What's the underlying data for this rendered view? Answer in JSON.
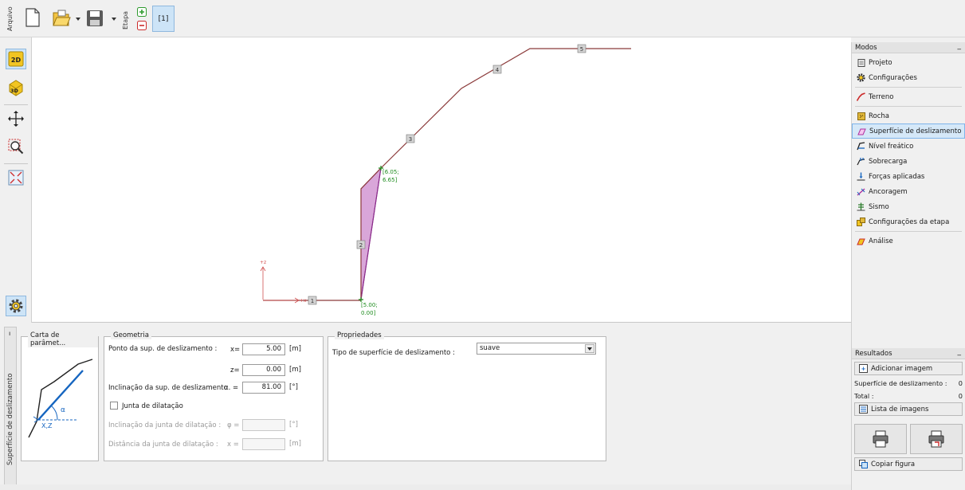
{
  "toolbar": {
    "file_label": "Arquivo",
    "stage_label": "Etapa",
    "stage_tab": "[1]"
  },
  "canvas": {
    "point_labels": [
      "1",
      "2",
      "3",
      "4",
      "5"
    ],
    "top_point_coord_line1": "[6.05;",
    "top_point_coord_line2": "6.65]",
    "bottom_point_coord_line1": "[5.00;",
    "bottom_point_coord_line2": "0.00]",
    "axis_z_label": "+z",
    "axis_x_label": "+x"
  },
  "modes": {
    "header": "Modos",
    "items": [
      {
        "label": "Projeto",
        "icon": "document-icon"
      },
      {
        "label": "Configurações",
        "icon": "gear-icon"
      },
      {
        "label": "Terreno",
        "icon": "terrain-icon"
      },
      {
        "label": "Rocha",
        "icon": "rock-icon"
      },
      {
        "label": "Superfície de deslizamento",
        "icon": "slip-surface-icon",
        "active": true
      },
      {
        "label": "Nível freático",
        "icon": "water-table-icon"
      },
      {
        "label": "Sobrecarga",
        "icon": "surcharge-icon"
      },
      {
        "label": "Forças aplicadas",
        "icon": "applied-forces-icon"
      },
      {
        "label": "Ancoragem",
        "icon": "anchor-icon"
      },
      {
        "label": "Sismo",
        "icon": "earthquake-icon"
      },
      {
        "label": "Configurações da etapa",
        "icon": "stage-settings-icon"
      },
      {
        "label": "Análise",
        "icon": "analysis-icon"
      }
    ]
  },
  "results": {
    "header": "Resultados",
    "add_image": "Adicionar imagem",
    "slip_label": "Superfície de deslizamento :",
    "slip_value": "0",
    "total_label": "Total :",
    "total_value": "0",
    "image_list": "Lista de imagens",
    "copy_figure": "Copiar figura"
  },
  "bottom": {
    "side_tab": "Superfície de deslizamento",
    "param_card": "Carta de parâmet...",
    "geometry": {
      "title": "Geometria",
      "point_label": "Ponto da sup. de deslizamento :",
      "x_prefix": "x=",
      "x_value": "5.00",
      "x_unit": "[m]",
      "z_prefix": "z=",
      "z_value": "0.00",
      "z_unit": "[m]",
      "incl_label": "Inclinação da sup. de deslizamento",
      "incl_prefix": "α. =",
      "incl_value": "81.00",
      "incl_unit": "[°]",
      "joint_checkbox": "Junta de dilatação",
      "joint_incl_label": "Inclinação da junta de dilatação :",
      "joint_incl_prefix": "φ =",
      "joint_incl_unit": "[°]",
      "joint_dist_label": "Distância da junta de dilatação :",
      "joint_dist_prefix": "x =",
      "joint_dist_unit": "[m]"
    },
    "properties": {
      "title": "Propriedades",
      "type_label": "Tipo de superfície de deslizamento :",
      "type_value": "suave"
    },
    "card_labels": {
      "alpha": "α",
      "xz": "X,Z"
    }
  },
  "colors": {
    "terrain": "#8b3a3a",
    "slip_fill": "#d9a6d9",
    "slip_stroke": "#8a2a8a",
    "point_green": "#1e8c1e",
    "accent_blue": "#1565c0"
  }
}
